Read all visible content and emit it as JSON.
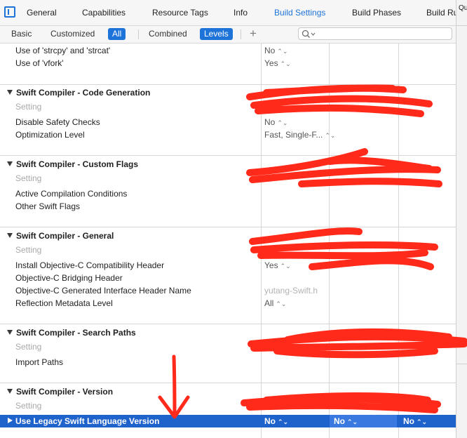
{
  "tabs": {
    "items": [
      {
        "label": "General"
      },
      {
        "label": "Capabilities"
      },
      {
        "label": "Resource Tags"
      },
      {
        "label": "Info"
      },
      {
        "label": "Build Settings"
      },
      {
        "label": "Build Phases"
      },
      {
        "label": "Build Ru"
      }
    ],
    "active": "Build Settings"
  },
  "inspector": {
    "label": "Qu"
  },
  "filters": {
    "basic": "Basic",
    "customized": "Customized",
    "all": "All",
    "combined": "Combined",
    "levels": "Levels",
    "add": "+",
    "search_value": ""
  },
  "top_rows": [
    {
      "label": "Use of 'strcpy' and 'strcat'",
      "value": "No"
    },
    {
      "label": "Use of 'vfork'",
      "value": "Yes"
    }
  ],
  "sections": [
    {
      "title": "Swift Compiler - Code Generation",
      "setting": "Setting",
      "rows": [
        {
          "label": "Disable Safety Checks",
          "value": "No"
        },
        {
          "label": "Optimization Level",
          "value": "Fast, Single-F..."
        }
      ]
    },
    {
      "title": "Swift Compiler - Custom Flags",
      "setting": "Setting",
      "rows": [
        {
          "label": "Active Compilation Conditions",
          "value": ""
        },
        {
          "label": "Other Swift Flags",
          "value": ""
        }
      ]
    },
    {
      "title": "Swift Compiler - General",
      "setting": "Setting",
      "rows": [
        {
          "label": "Install Objective-C Compatibility Header",
          "value": "Yes"
        },
        {
          "label": "Objective-C Bridging Header",
          "value": ""
        },
        {
          "label": "Objective-C Generated Interface Header Name",
          "value": "yutang-Swift.h"
        },
        {
          "label": "Reflection Metadata Level",
          "value": "All"
        }
      ]
    },
    {
      "title": "Swift Compiler - Search Paths",
      "setting": "Setting",
      "rows": [
        {
          "label": "Import Paths",
          "value": ""
        }
      ]
    },
    {
      "title": "Swift Compiler - Version",
      "setting": "Setting",
      "rows": [
        {
          "label": "Use Legacy Swift Language Version",
          "values": [
            "No",
            "No",
            "No"
          ]
        }
      ]
    }
  ],
  "stepper_glyph": "⌃⌄",
  "colors": {
    "accent": "#1e73d9",
    "selection": "#1e62cc",
    "annotation": "#ff2a1a"
  }
}
